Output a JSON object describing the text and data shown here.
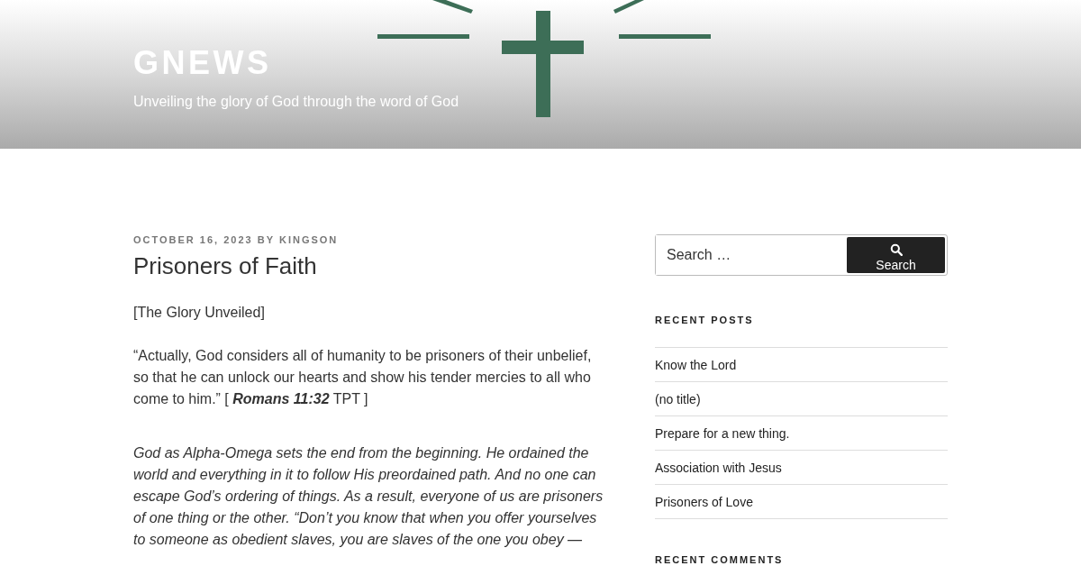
{
  "site": {
    "title": "GNEWS",
    "tagline": "Unveiling the glory of God through the word of God"
  },
  "post": {
    "date": "OCTOBER 16, 2023",
    "by": "BY",
    "author": "KINGSON",
    "title": "Prisoners of Faith",
    "paragraphs": [
      {
        "kind": "plain",
        "text": "[The Glory Unveiled]"
      },
      {
        "kind": "plain",
        "text": "“Actually, God considers all of humanity to be prisoners of their unbelief, so that he can unlock our hearts and show his tender mercies to all who come to him.” [ **Romans 11:32** TPT ]"
      },
      {
        "kind": "italic",
        "text": "God as Alpha-Omega sets the end from the beginning. He ordained the world and everything in it to follow His preordained path. And no one can escape God’s ordering of things. As a result, everyone of us are prisoners of one thing or the other. “Don’t you know that when you offer yourselves to someone as obedient slaves, you are slaves of the one you obey —"
      }
    ]
  },
  "sidebar": {
    "search": {
      "placeholder": "Search …",
      "button": "Search"
    },
    "recent_posts": {
      "heading": "RECENT POSTS",
      "items": [
        "Know the Lord",
        "(no title)",
        "Prepare for a new thing.",
        "Association with Jesus",
        "Prisoners of Love"
      ]
    },
    "recent_comments": {
      "heading": "RECENT COMMENTS"
    }
  }
}
